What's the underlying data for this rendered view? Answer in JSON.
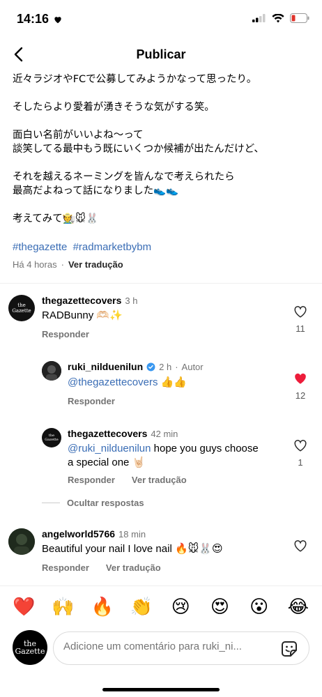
{
  "status_bar": {
    "time": "14:16"
  },
  "nav": {
    "title": "Publicar"
  },
  "caption": {
    "lines": [
      "近々ラジオやFCで公募してみようかなって思ったり。",
      "そしたらより愛着が湧きそうな気がする笑。",
      "面白い名前がいいよね〜って",
      "談笑してる最中もう既にいくつか候補が出たんだけど、",
      "それを越えるネーミングを皆んなで考えられたら",
      "最高だよねって話になりました👟👟",
      "考えてみて🧑‍🌾🐭🐰"
    ],
    "hashtags": [
      "#thegazette",
      "#radmarketbybm"
    ],
    "time": "Há 4 horas",
    "separator": "·",
    "translate": "Ver tradução"
  },
  "comments": [
    {
      "user": "thegazettecovers",
      "time": "3 h",
      "text": "RADBunny 🫶🏻✨",
      "reply": "Responder",
      "likes": "11",
      "liked": false
    },
    {
      "user": "ruki_nilduenilun",
      "time": "2 h",
      "author_sep": "·",
      "author": "Autor",
      "mention": "@thegazettecovers",
      "text": " 👍👍",
      "reply": "Responder",
      "likes": "12",
      "liked": true
    },
    {
      "user": "thegazettecovers",
      "time": "42 min",
      "mention": "@ruki_nilduenilun",
      "text_line1": " hope you guys choose",
      "text_line2": "a special one 🤘🏻",
      "reply": "Responder",
      "translate": "Ver tradução",
      "likes": "1",
      "liked": false
    },
    {
      "user": "angelworld5766",
      "time": "18 min",
      "text": "Beautiful your nail I love nail 🔥🐭🐰😍",
      "reply": "Responder",
      "translate": "Ver tradução",
      "liked": false
    }
  ],
  "hide_replies": "Ocultar respostas",
  "emoji_bar": [
    "❤️",
    "🙌",
    "🔥",
    "👏",
    "😢",
    "😍",
    "😮",
    "😂"
  ],
  "composer": {
    "placeholder": "Adicione um comentário para ruki_ni...",
    "avatar_label": "the Gazette"
  },
  "colors": {
    "link": "#3a6db5",
    "like_active": "#ed1c3a",
    "muted": "#737373"
  }
}
